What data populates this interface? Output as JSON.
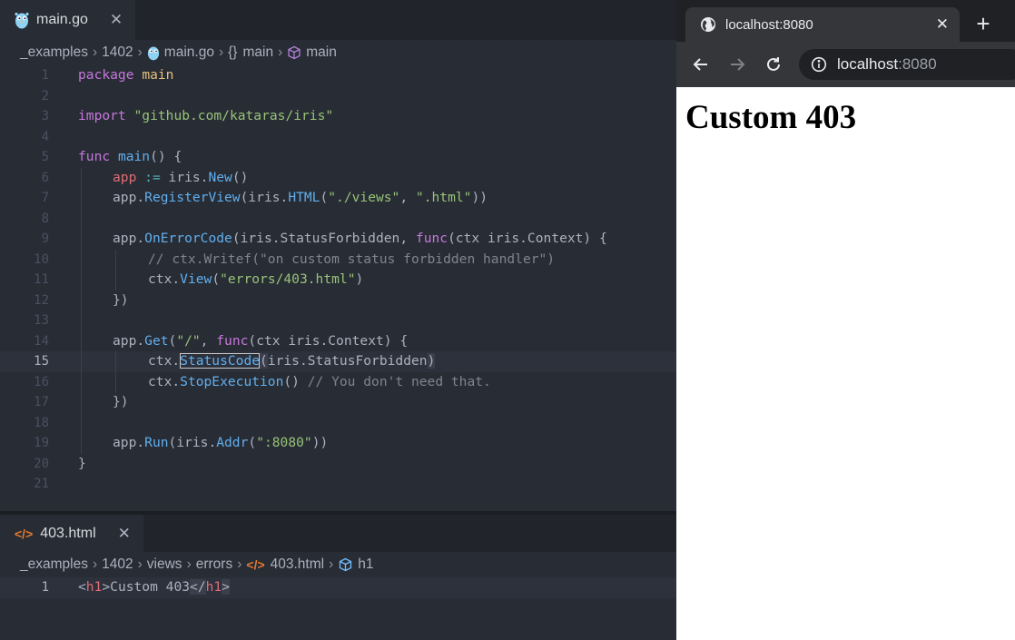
{
  "editor": {
    "top_tab": {
      "name": "main.go",
      "close": "✕"
    },
    "top_breadcrumb": {
      "items": [
        "_examples",
        "1402",
        "main.go",
        "main",
        "main"
      ],
      "symbol_braces": "{}",
      "sep": "›"
    },
    "main_go_lines": [
      "1",
      "2",
      "3",
      "4",
      "5",
      "6",
      "7",
      "8",
      "9",
      "10",
      "11",
      "12",
      "13",
      "14",
      "15",
      "16",
      "17",
      "18",
      "19",
      "20",
      "21"
    ],
    "code": {
      "l1": [
        "package",
        "main"
      ],
      "l3": [
        "import",
        "\"github.com/kataras/iris\""
      ],
      "l5": [
        "func",
        "main",
        "() {"
      ],
      "l6": [
        "app",
        ":=",
        "iris.",
        "New",
        "()"
      ],
      "l7": [
        "app.",
        "RegisterView",
        "(iris.",
        "HTML",
        "(",
        "\"./views\"",
        ", ",
        "\".html\"",
        "))"
      ],
      "l9": [
        "app.",
        "OnErrorCode",
        "(iris.StatusForbidden, ",
        "func",
        "(ctx iris.Context) {"
      ],
      "l10": [
        "// ctx.Writef(\"on custom status forbidden handler\")"
      ],
      "l11": [
        "ctx.",
        "View",
        "(",
        "\"errors/403.html\"",
        ")"
      ],
      "l12": [
        "})"
      ],
      "l14": [
        "app.",
        "Get",
        "(",
        "\"/\"",
        ", ",
        "func",
        "(ctx iris.Context) {"
      ],
      "l15": [
        "ctx.",
        "StatusCode",
        "(",
        "iris.StatusForbidden",
        ")"
      ],
      "l16": [
        "ctx.",
        "StopExecution",
        "() ",
        "// You don't need that."
      ],
      "l17": [
        "})"
      ],
      "l19": [
        "app.",
        "Run",
        "(iris.",
        "Addr",
        "(",
        "\":8080\"",
        "))"
      ],
      "l20": [
        "}"
      ]
    },
    "bottom_tab": {
      "name": "403.html",
      "close": "✕",
      "icon_glyph": "</>"
    },
    "bottom_breadcrumb": {
      "items": [
        "_examples",
        "1402",
        "views",
        "errors",
        "403.html",
        "h1"
      ],
      "sep": "›",
      "icon_glyph": "</>"
    },
    "html_line_number": "1",
    "html_code": [
      "<",
      "h1",
      ">Custom 403",
      "</",
      "h1",
      ">"
    ]
  },
  "browser": {
    "tab_title": "localhost:8080",
    "tab_close": "✕",
    "new_tab": "+",
    "address_host": "localhost",
    "address_port": ":8080",
    "page_heading": "Custom 403"
  },
  "colors": {
    "keyword": "#c678dd",
    "function": "#61afef",
    "string": "#98c379",
    "variable": "#e06c75",
    "comment": "#7f848e",
    "editor_bg": "#282c34",
    "browser_toolbar": "#35363a"
  },
  "icons": {
    "go_file": "gopher-icon",
    "html_file": "html-file-icon",
    "globe": "globe-icon",
    "info": "info-icon"
  }
}
